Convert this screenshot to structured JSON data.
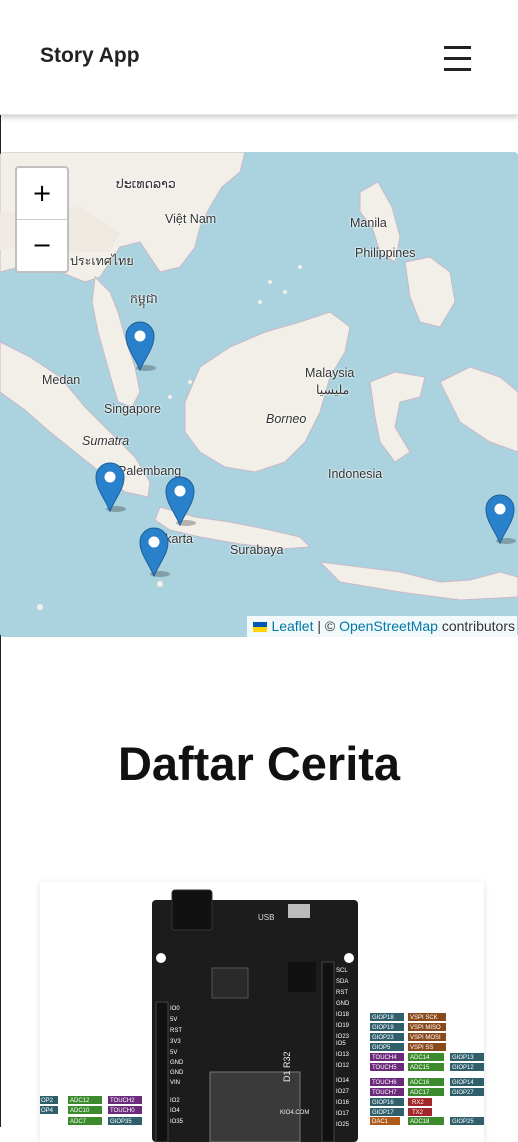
{
  "header": {
    "title": "Story App",
    "menu_icon": "hamburger-icon"
  },
  "map": {
    "zoom_in": "+",
    "zoom_out": "−",
    "labels": {
      "thai": "ประเทศไทย",
      "lao": "ປະເທດລາວ",
      "vietnam": "Việt Nam",
      "cambodia": "កម្ពុជា",
      "manila": "Manila",
      "philippines": "Philippines",
      "malaysia": "Malaysia",
      "malaysia_jawi": "مليسيا",
      "medan": "Medan",
      "singapore": "Singapore",
      "borneo": "Borneo",
      "sumatra": "Sumatra",
      "palembang": "Palembang",
      "indonesia": "Indonesia",
      "jakarta": "Jakarta",
      "surabaya": "Surabaya"
    },
    "marker_count": 5,
    "attribution": {
      "leaflet": "Leaflet",
      "separator": "| ©",
      "osm": "OpenStreetMap",
      "suffix": "contributors"
    }
  },
  "section": {
    "title": "Daftar Cerita"
  },
  "story_card": {
    "image_alt": "ESP32 D1 R32 pinout board",
    "board_labels": {
      "usb": "USB",
      "model": "D1 R32",
      "site": "KIO4.COM",
      "pins_right": [
        "SCL",
        "SDA",
        "RST",
        "GND",
        "IO18",
        "IO19",
        "IO23",
        "IO5",
        "IO13",
        "IO12",
        "IO14",
        "IO27",
        "IO16",
        "IO17",
        "IO25"
      ],
      "pins_left": [
        "IO0",
        "5V",
        "RST",
        "3V3",
        "5V",
        "GND",
        "GND",
        "VIN",
        "IO2",
        "IO4",
        "IO35"
      ],
      "tags": [
        "GIOP18",
        "VSPI SCK",
        "GIOP19",
        "VSPI MISO",
        "GIOP23",
        "VSPI MOSI",
        "GIOP5",
        "VSPI SS",
        "TOUCH4",
        "ADC14",
        "GIOP13",
        "TOUCH5",
        "ADC15",
        "GIOP12",
        "TOUCH6",
        "ADC16",
        "GIOP14",
        "TOUCH7",
        "ADC17",
        "GIOP27",
        "GIOP16",
        "RX2",
        "GIOP17",
        "TX2",
        "DAC1",
        "ADC18",
        "GIOP25",
        "OP2",
        "ADC12",
        "TOUCH2",
        "OP4",
        "ADC10",
        "TOUCH0",
        "ADC7",
        "GIOP35"
      ]
    }
  }
}
